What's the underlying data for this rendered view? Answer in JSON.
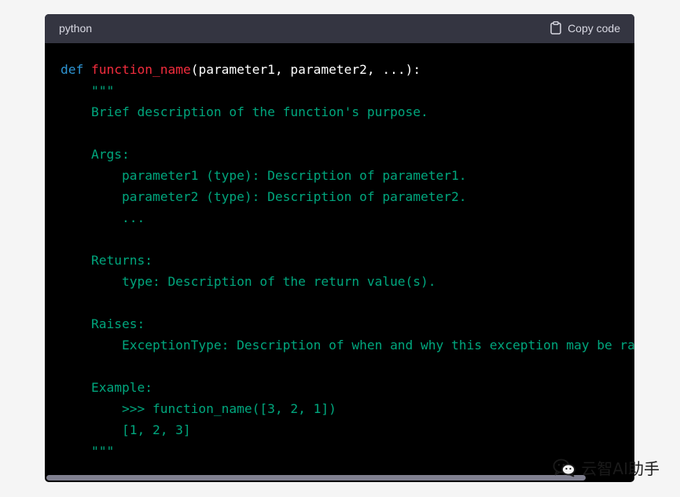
{
  "header": {
    "language": "python",
    "copy_label": "Copy code"
  },
  "code": {
    "line1": {
      "def": "def",
      "name": "function_name",
      "params": "(parameter1, parameter2, ...):"
    },
    "docstring": "    \"\"\"\n    Brief description of the function's purpose.\n\n    Args:\n        parameter1 (type): Description of parameter1.\n        parameter2 (type): Description of parameter2.\n        ...\n\n    Returns:\n        type: Description of the return value(s).\n\n    Raises:\n        ExceptionType: Description of when and why this exception may be raised.\n\n    Example:\n        >>> function_name([3, 2, 1])\n        [1, 2, 3]\n    \"\"\""
  },
  "watermark": {
    "text": "云智AI助手",
    "icon": "wechat-icon"
  }
}
